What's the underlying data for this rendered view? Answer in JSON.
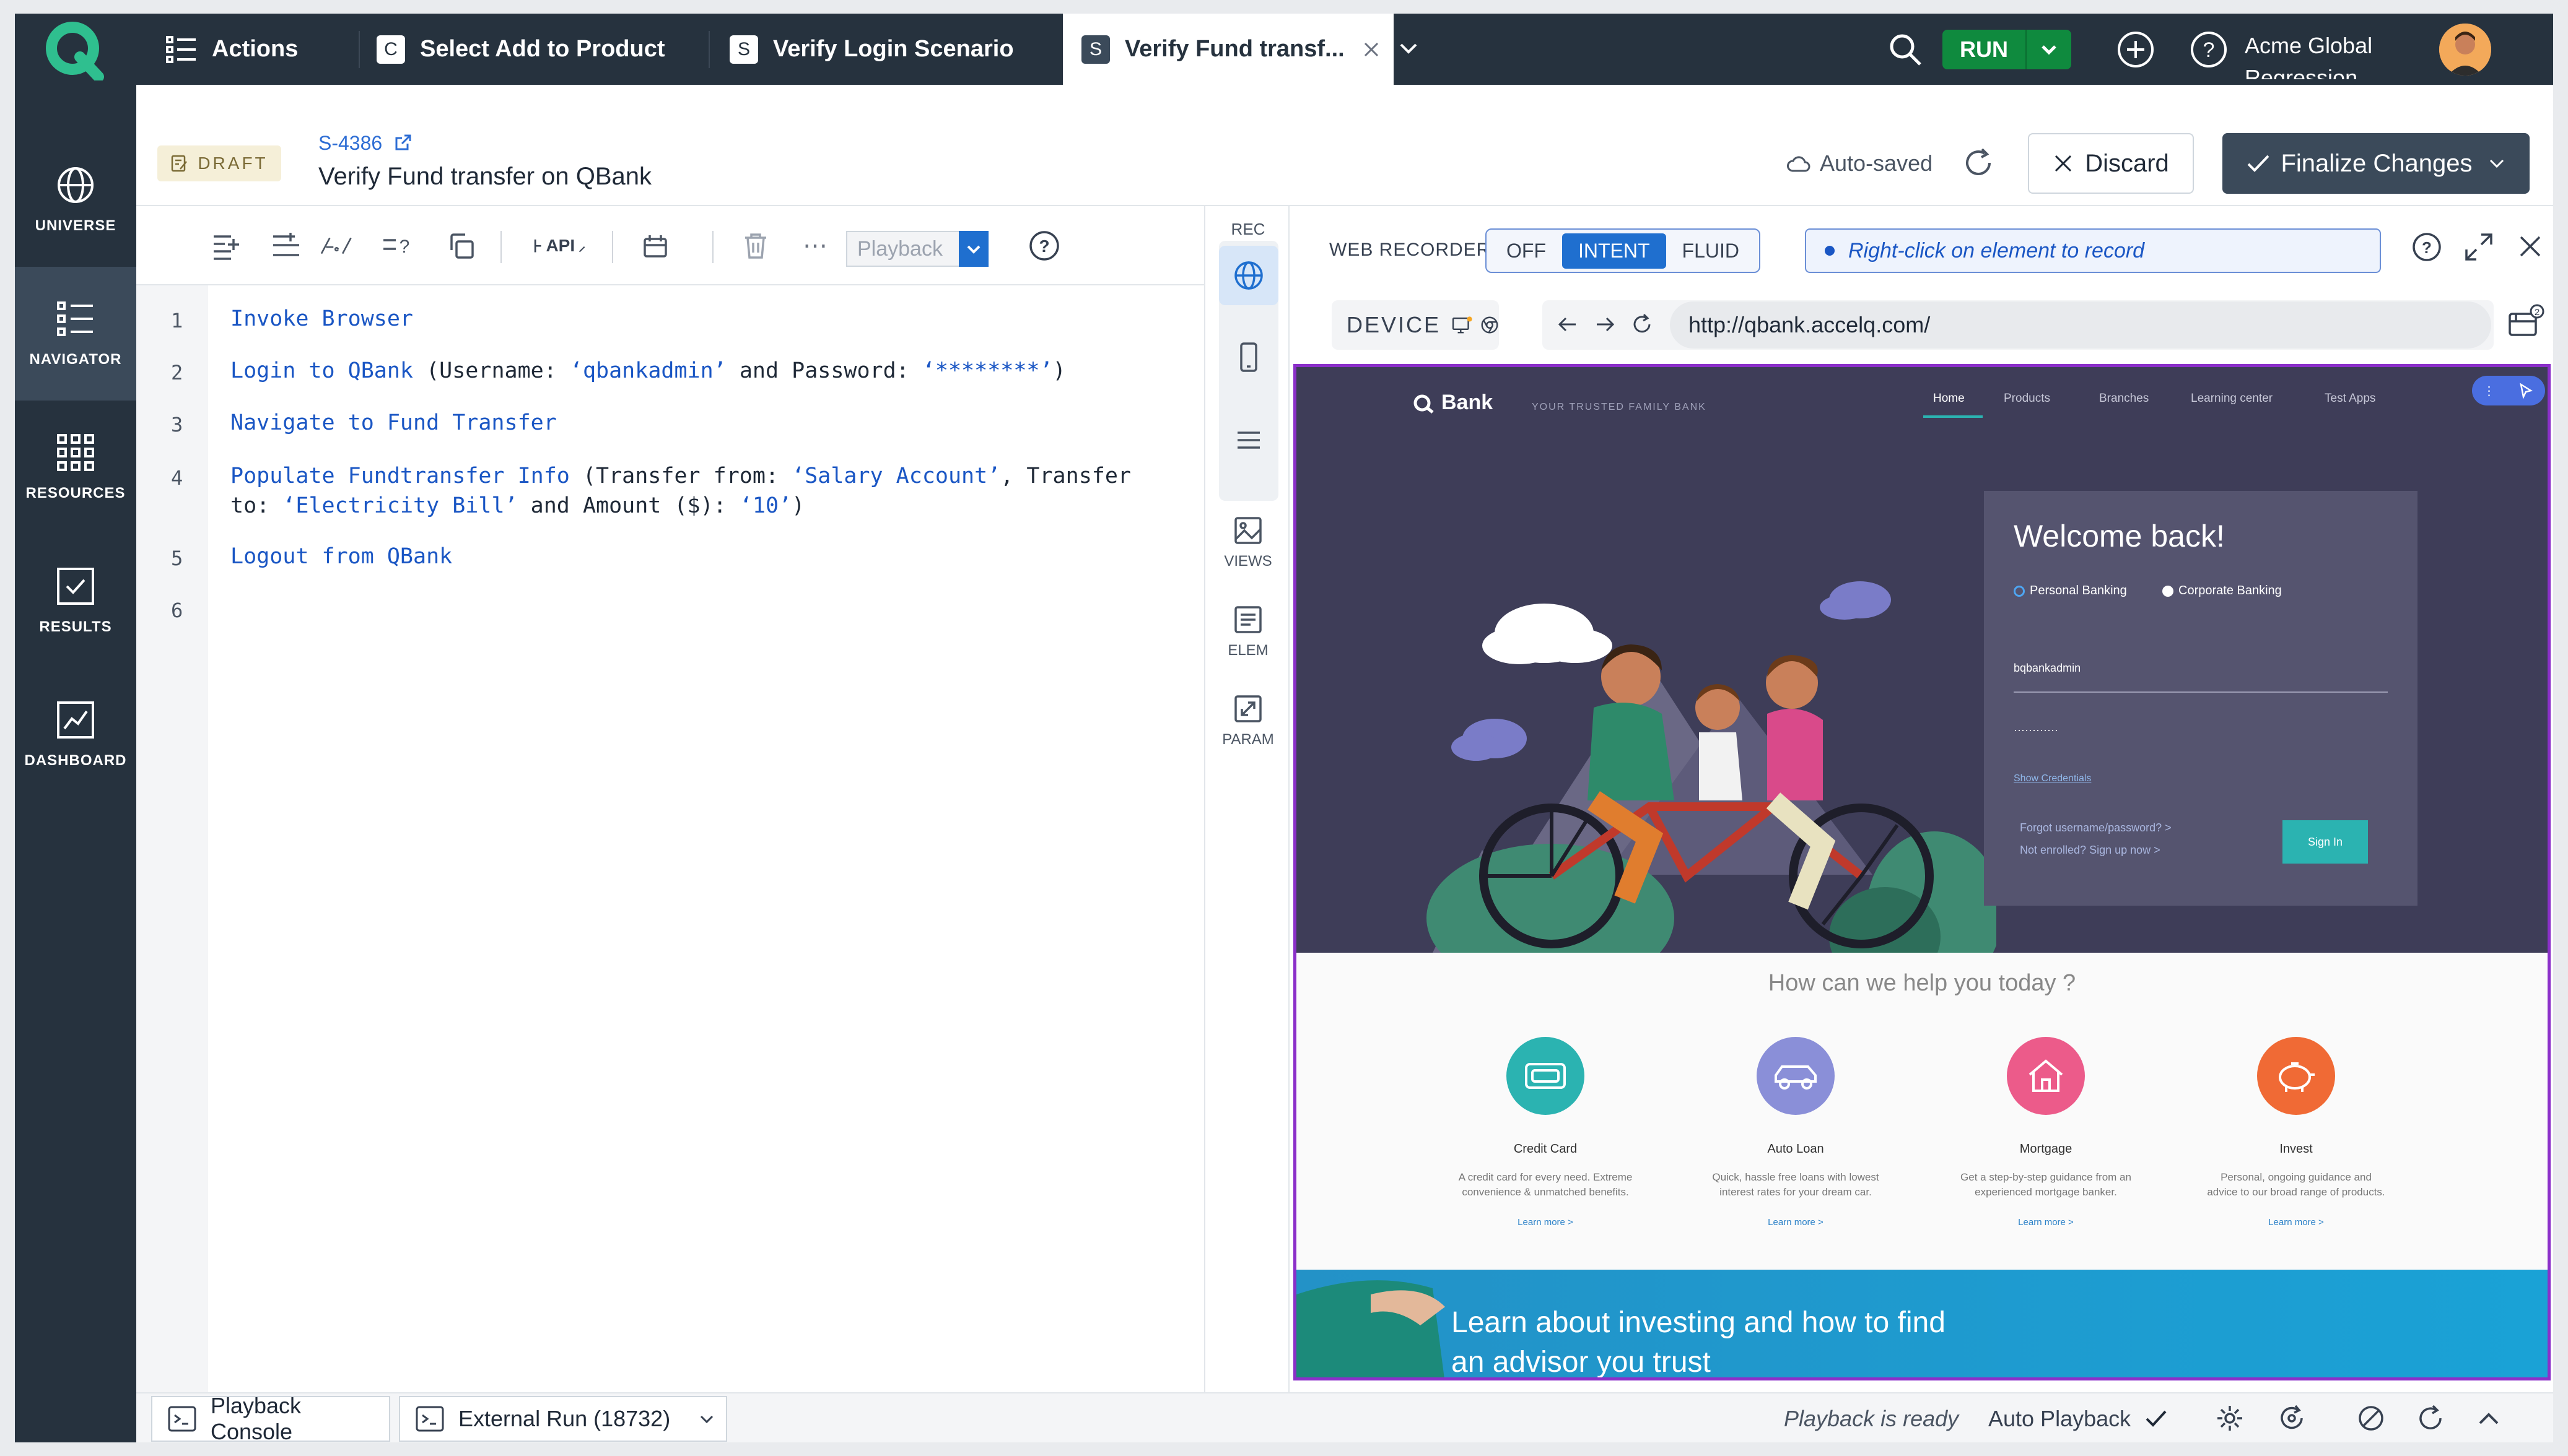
{
  "topbar": {
    "tabs": [
      {
        "badge": "",
        "label": "Actions"
      },
      {
        "badge": "C",
        "label": "Select Add to Product"
      },
      {
        "badge": "S",
        "label": "Verify Login Scenario"
      },
      {
        "badge": "S",
        "label": "Verify Fund transf..."
      }
    ],
    "run_label": "RUN",
    "project_line1": "Acme Global",
    "project_line2": "Regression"
  },
  "sidebar": {
    "items": [
      {
        "label": "UNIVERSE",
        "icon": "globe-icon"
      },
      {
        "label": "NAVIGATOR",
        "icon": "list-icon"
      },
      {
        "label": "RESOURCES",
        "icon": "grid-icon"
      },
      {
        "label": "RESULTS",
        "icon": "checkbox-icon"
      },
      {
        "label": "DASHBOARD",
        "icon": "chart-icon"
      }
    ]
  },
  "header": {
    "status": "DRAFT",
    "scenario_id": "S-4386",
    "title": "Verify Fund transfer on QBank",
    "autosaved": "Auto-saved",
    "discard_label": "Discard",
    "finalize_label": "Finalize Changes"
  },
  "toolbar": {
    "api_label": "API",
    "playback_placeholder": "Playback"
  },
  "code": {
    "line_numbers": [
      "1",
      "2",
      "3",
      "4",
      "5",
      "6"
    ],
    "l1": "Invoke Browser",
    "l2a": "Login to QBank",
    "l2b": " (Username: ",
    "l2c": "‘qbankadmin’",
    "l2d": " and Password: ",
    "l2e": "‘********’",
    "l2f": ")",
    "l3": "Navigate to Fund Transfer",
    "l4a": "Populate Fundtransfer Info",
    "l4b": " (Transfer from: ",
    "l4c": "‘Salary Account’",
    "l4d": ", Transfer",
    "l4e": "to: ",
    "l4f": "‘Electricity Bill’",
    "l4g": " and Amount ($): ",
    "l4h": "‘10’",
    "l4i": ")",
    "l5": "Logout from QBank"
  },
  "rail": {
    "rec": "REC",
    "views": "VIEWS",
    "elem": "ELEM",
    "param": "PARAM"
  },
  "recorder": {
    "label": "WEB RECORDER",
    "modes": [
      "OFF",
      "INTENT",
      "FLUID"
    ],
    "active_mode": "INTENT",
    "hint": "Right-click on element to record",
    "device_label": "DEVICE",
    "url": "http://qbank.accelq.com/"
  },
  "bank": {
    "brand": "Bank",
    "tagline": "YOUR TRUSTED FAMILY BANK",
    "nav": [
      "Home",
      "Products",
      "Branches",
      "Learning center",
      "Test Apps"
    ],
    "welcome": "Welcome back!",
    "radio1": "Personal Banking",
    "radio2": "Corporate Banking",
    "username": "bqbankadmin",
    "password": "············",
    "show_credentials": "Show Credentials",
    "forgot": "Forgot username/password?  >",
    "enroll": "Not enrolled? Sign up now  >",
    "sign_in": "Sign In",
    "help_title": "How can we help you today ?",
    "services": [
      {
        "title": "Credit Card",
        "desc1": "A credit card for every need. Extreme",
        "desc2": "convenience & unmatched benefits.",
        "link": "Learn more  >",
        "color": "#2bb3b1"
      },
      {
        "title": "Auto Loan",
        "desc1": "Quick, hassle free loans with lowest",
        "desc2": "interest rates for your dream car.",
        "link": "Learn more  >",
        "color": "#8a8fd8"
      },
      {
        "title": "Mortgage",
        "desc1": "Get a step-by-step guidance from an",
        "desc2": "experienced mortgage banker.",
        "link": "Learn more  >",
        "color": "#ec5b8a"
      },
      {
        "title": "Invest",
        "desc1": "Personal, ongoing guidance and",
        "desc2": "advice to our broad range of products.",
        "link": "Learn more  >",
        "color": "#f06a35"
      }
    ],
    "banner_line1": "Learn about investing and how to find",
    "banner_line2": "an advisor you trust"
  },
  "bottom": {
    "tab1": "Playback Console",
    "tab2": "External Run (18732)",
    "status": "Playback is ready",
    "auto_playback": "Auto Playback"
  }
}
